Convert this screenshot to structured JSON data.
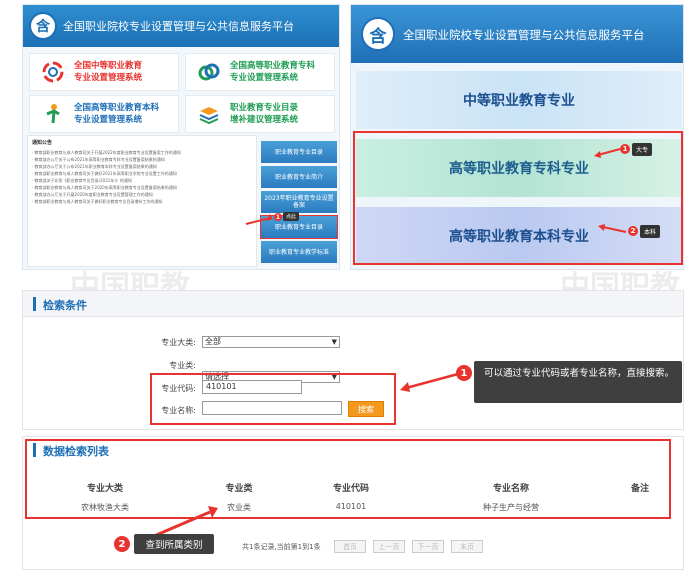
{
  "left_panel": {
    "logo_glyph": "含",
    "title": "全国职业院校专业设置管理与公共信息服务平台",
    "systems": [
      {
        "line1": "全国中等职业教育",
        "line2": "专业设置管理系统",
        "icon": "ring-icon",
        "color": "#e8332e"
      },
      {
        "line1": "全国高等职业教育专科",
        "line2": "专业设置管理系统",
        "icon": "swirl-icon",
        "color": "#1f9d55"
      },
      {
        "line1": "全国高等职业教育本科",
        "line2": "专业设置管理系统",
        "icon": "figure-icon",
        "color": "#1f6fb6"
      },
      {
        "line1": "职业教育专业目录",
        "line2": "增补建议管理系统",
        "icon": "layers-icon",
        "color": "#f39a1e"
      }
    ],
    "news_head": "通知公告",
    "news": [
      "· 教育部职业教育与成人教育司关于开展2022年度职业教育专业设置备案工作的通知",
      "· 教育部办公厅关于公布2021年高等职业教育专科专业设置备案结果的通知",
      "· 教育部办公厅关于公布2021年职业教育本科专业设置备案结果的通知",
      "· 教育部职业教育与成人教育司关于做好2021年高等职业学校专业设置工作的通知",
      "· 教育部关于印发《职业教育专业目录(2021年)》的通知",
      "· 教育部职业教育与成人教育司关于2020年高等职业教育专业设置备案结果的通知",
      "· 教育部办公厅关于开展2020年度职业教育专业设置管理工作的通知",
      "· 教育部职业教育与成人教育司关于做好职业教育专业目录增补工作的通知"
    ],
    "side_buttons": [
      "职业教育专业目录",
      "职业教育专业简介",
      "2023年职业教育专业设置备案",
      "职业教育专业目录",
      "职业教育专业教学标准"
    ],
    "callout_label": "点此",
    "callout_num": "1"
  },
  "right_panel": {
    "logo_glyph": "含",
    "title": "全国职业院校专业设置管理与公共信息服务平台",
    "banners": [
      "中等职业教育专业",
      "高等职业教育专科专业",
      "高等职业教育本科专业"
    ],
    "callouts": [
      {
        "num": "1",
        "label": "大专"
      },
      {
        "num": "2",
        "label": "本科"
      }
    ]
  },
  "watermark": "中国职教",
  "search": {
    "title": "检索条件",
    "fields": {
      "major_category_label": "专业大类:",
      "major_category_value": "全部",
      "major_class_label": "专业类:",
      "major_class_value": "请选择",
      "code_label": "专业代码:",
      "code_value": "410101",
      "name_label": "专业名称:",
      "name_value": ""
    },
    "button": "搜索",
    "tip_num": "1",
    "tip_text": "可以通过专业代码或者专业名称，直接搜索。"
  },
  "results": {
    "title": "数据检索列表",
    "headers": [
      "专业大类",
      "专业类",
      "专业代码",
      "专业名称",
      "备注"
    ],
    "rows": [
      [
        "农林牧渔大类",
        "农业类",
        "410101",
        "种子生产与经营",
        ""
      ]
    ],
    "tip_num": "2",
    "tip_text": "查到所属类别",
    "pager_text": "共1条记录,当前第1到1条",
    "pager_buttons": [
      "首页",
      "上一页",
      "下一页",
      "末页"
    ]
  },
  "colors": {
    "accent": "#1f6fb6",
    "highlight": "#e8332e",
    "button": "#f39a1e"
  }
}
